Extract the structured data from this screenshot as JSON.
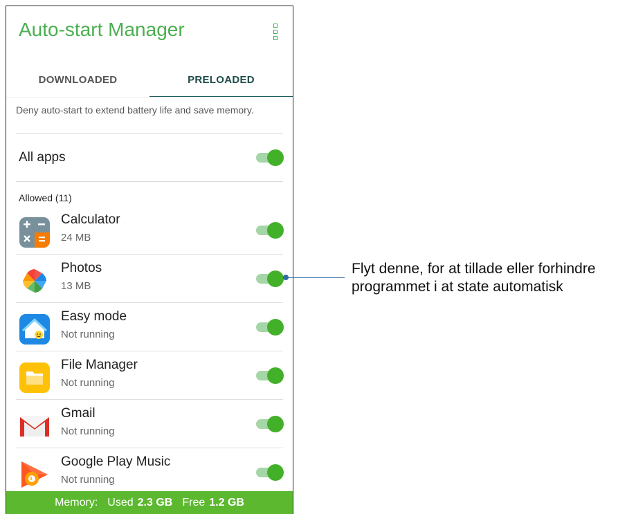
{
  "app": {
    "title": "Auto-start Manager"
  },
  "tabs": [
    {
      "label": "DOWNLOADED"
    },
    {
      "label": "PRELOADED"
    }
  ],
  "description": "Deny auto-start to extend battery life and save memory.",
  "all_apps": {
    "label": "All apps",
    "enabled": true
  },
  "section_label": "Allowed (11)",
  "apps": [
    {
      "name": "Calculator",
      "status": "24 MB",
      "icon": "calculator-icon",
      "enabled": true
    },
    {
      "name": "Photos",
      "status": "13 MB",
      "icon": "photos-icon",
      "enabled": true
    },
    {
      "name": "Easy mode",
      "status": "Not running",
      "icon": "easy-mode-icon",
      "enabled": true
    },
    {
      "name": "File Manager",
      "status": "Not running",
      "icon": "file-manager-icon",
      "enabled": true
    },
    {
      "name": "Gmail",
      "status": "Not running",
      "icon": "gmail-icon",
      "enabled": true
    },
    {
      "name": "Google Play Music",
      "status": "Not running",
      "icon": "play-music-icon",
      "enabled": true
    }
  ],
  "footer": {
    "memory_label": "Memory:",
    "used_label": "Used",
    "used_value": "2.3 GB",
    "free_label": "Free",
    "free_value": "1.2 GB"
  },
  "annotation": {
    "line1": "Flyt denne, for at tillade eller forhindre",
    "line2": "programmet i at state automatisk"
  },
  "colors": {
    "accent": "#4caf50",
    "toggle_thumb": "#43b02a",
    "toggle_track": "#a5d6a7",
    "footer_bg": "#5cb82f",
    "callout": "#2f6aa5"
  }
}
